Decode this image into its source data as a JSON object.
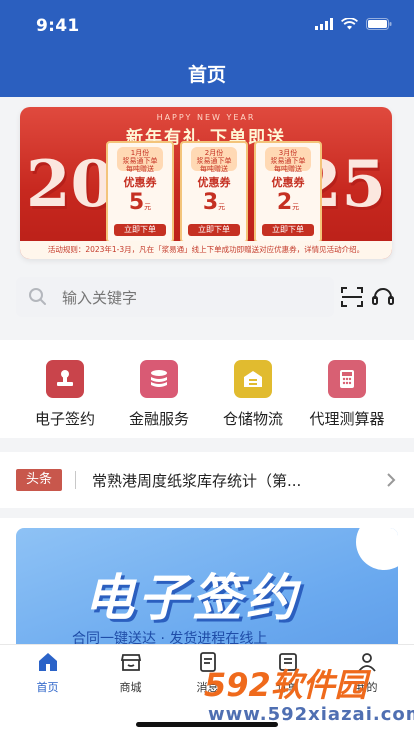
{
  "status": {
    "time": "9:41"
  },
  "header": {
    "title": "首页"
  },
  "banner": {
    "eyebrow": "HAPPY NEW YEAR",
    "headline": "新年有礼 下单即送",
    "year_left": "20",
    "year_right": "25",
    "coupons": [
      {
        "month": "1月份\n浆易通下单\n每吨赠送",
        "type": "优惠券",
        "amount": "5",
        "unit": "元",
        "cta": "立即下单"
      },
      {
        "month": "2月份\n浆易通下单\n每吨赠送",
        "type": "优惠券",
        "amount": "3",
        "unit": "元",
        "cta": "立即下单"
      },
      {
        "month": "3月份\n浆易通下单\n每吨赠送",
        "type": "优惠券",
        "amount": "2",
        "unit": "元",
        "cta": "立即下单"
      }
    ],
    "rules": "活动规则：2023年1-3月，凡在「浆易通」线上下单成功即赠送对应优惠券，详情见活动介绍。"
  },
  "search": {
    "placeholder": "输入关键字"
  },
  "quick": [
    {
      "label": "电子签约",
      "color": "#c9444b",
      "icon": "stamp-icon"
    },
    {
      "label": "金融服务",
      "color": "#d95a74",
      "icon": "coins-icon"
    },
    {
      "label": "仓储物流",
      "color": "#e1bb2f",
      "icon": "warehouse-icon"
    },
    {
      "label": "代理测算器",
      "color": "#d86073",
      "icon": "calculator-icon"
    }
  ],
  "news": {
    "tag": "头条",
    "headline": "常熟港周度纸浆库存统计（第..."
  },
  "promo": {
    "title": "电子签约",
    "subtitle": "合同一键送达 · 发货进程在线上"
  },
  "tabs": [
    {
      "label": "首页",
      "active": true,
      "icon": "home-icon"
    },
    {
      "label": "商城",
      "active": false,
      "icon": "store-icon"
    },
    {
      "label": "消息",
      "active": false,
      "icon": "message-icon"
    },
    {
      "label": "订单",
      "active": false,
      "icon": "order-icon"
    },
    {
      "label": "我的",
      "active": false,
      "icon": "profile-icon"
    }
  ],
  "watermark": {
    "brand": "592软件园",
    "url": "www.592xiazai.com"
  },
  "colors": {
    "primary": "#2b5fbf",
    "tab_active": "#2b63c8",
    "banner_red": "#c7281f",
    "watermark_orange": "#ef6a1c"
  }
}
